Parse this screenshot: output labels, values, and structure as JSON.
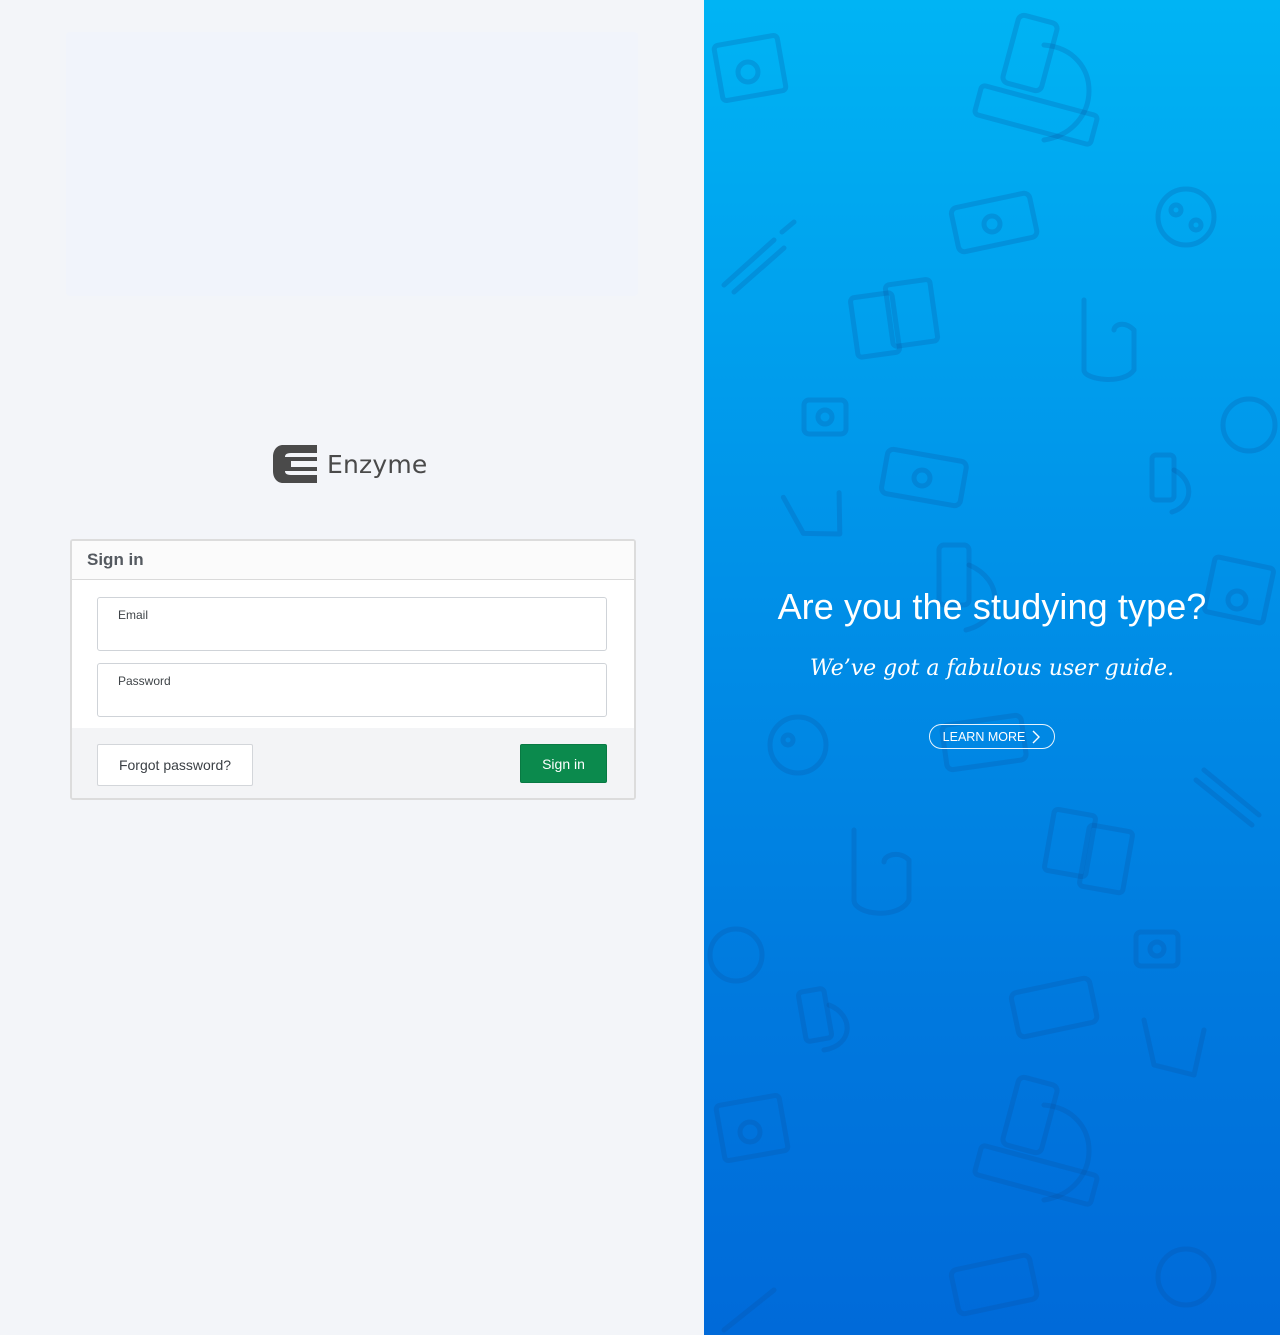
{
  "brand": {
    "name": "Enzyme"
  },
  "signin_card": {
    "title": "Sign in",
    "email_label": "Email",
    "email_value": "",
    "password_label": "Password",
    "password_value": "",
    "forgot_label": "Forgot password?",
    "submit_label": "Sign in"
  },
  "promo": {
    "heading": "Are you the studying type?",
    "subheading": "We’ve got a fabulous user guide.",
    "cta_label": "LEARN MORE",
    "cta_icon": "chevron-right-icon",
    "background_top": "#00b4f4",
    "background_bottom": "#006ad9"
  },
  "colors": {
    "primary_button": "#0b8a4d",
    "left_background": "#f3f5f9"
  },
  "icons": [
    "enzyme-logo-icon",
    "microscope-icon",
    "ambulance-icon",
    "syringe-icon",
    "petri-dish-icon",
    "stethoscope-icon",
    "flask-icon",
    "hand-icon",
    "medical-bag-icon",
    "file-icon"
  ]
}
